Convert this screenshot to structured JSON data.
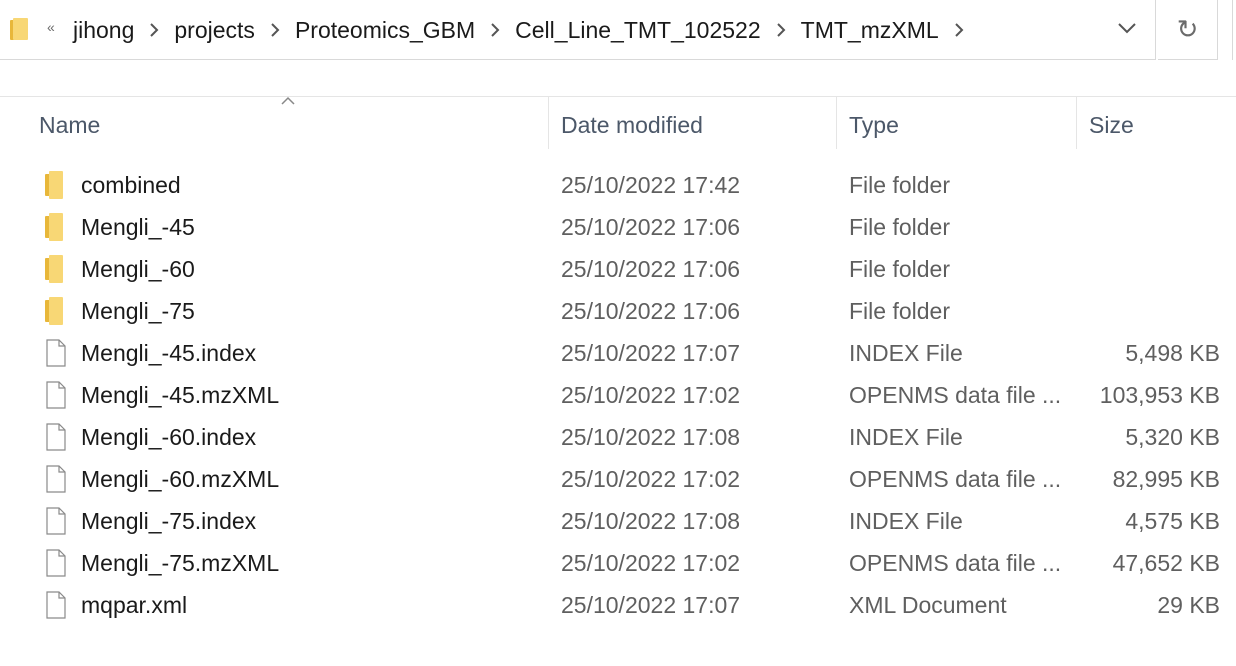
{
  "address_bar": {
    "overflow_label": "«",
    "breadcrumbs": [
      "jihong",
      "projects",
      "Proteomics_GBM",
      "Cell_Line_TMT_102522",
      "TMT_mzXML"
    ],
    "refresh_label": "↻"
  },
  "columns": {
    "name": "Name",
    "date": "Date modified",
    "type": "Type",
    "size": "Size"
  },
  "files": [
    {
      "icon": "folder-icon",
      "name": "combined",
      "date": "25/10/2022 17:42",
      "type": "File folder",
      "size": ""
    },
    {
      "icon": "folder-icon",
      "name": "Mengli_-45",
      "date": "25/10/2022 17:06",
      "type": "File folder",
      "size": ""
    },
    {
      "icon": "folder-icon",
      "name": "Mengli_-60",
      "date": "25/10/2022 17:06",
      "type": "File folder",
      "size": ""
    },
    {
      "icon": "folder-icon",
      "name": "Mengli_-75",
      "date": "25/10/2022 17:06",
      "type": "File folder",
      "size": ""
    },
    {
      "icon": "file-icon",
      "name": "Mengli_-45.index",
      "date": "25/10/2022 17:07",
      "type": "INDEX File",
      "size": "5,498 KB"
    },
    {
      "icon": "file-icon",
      "name": "Mengli_-45.mzXML",
      "date": "25/10/2022 17:02",
      "type": "OPENMS data file ...",
      "size": "103,953 KB"
    },
    {
      "icon": "file-icon",
      "name": "Mengli_-60.index",
      "date": "25/10/2022 17:08",
      "type": "INDEX File",
      "size": "5,320 KB"
    },
    {
      "icon": "file-icon",
      "name": "Mengli_-60.mzXML",
      "date": "25/10/2022 17:02",
      "type": "OPENMS data file ...",
      "size": "82,995 KB"
    },
    {
      "icon": "file-icon",
      "name": "Mengli_-75.index",
      "date": "25/10/2022 17:08",
      "type": "INDEX File",
      "size": "4,575 KB"
    },
    {
      "icon": "file-icon",
      "name": "Mengli_-75.mzXML",
      "date": "25/10/2022 17:02",
      "type": "OPENMS data file ...",
      "size": "47,652 KB"
    },
    {
      "icon": "file-icon",
      "name": "mqpar.xml",
      "date": "25/10/2022 17:07",
      "type": "XML Document",
      "size": "29 KB"
    }
  ],
  "colors": {
    "folder": "#f8d775",
    "folder_dark": "#e8b73a",
    "header_text": "#4c5869",
    "secondary_text": "#5f5f5f"
  }
}
